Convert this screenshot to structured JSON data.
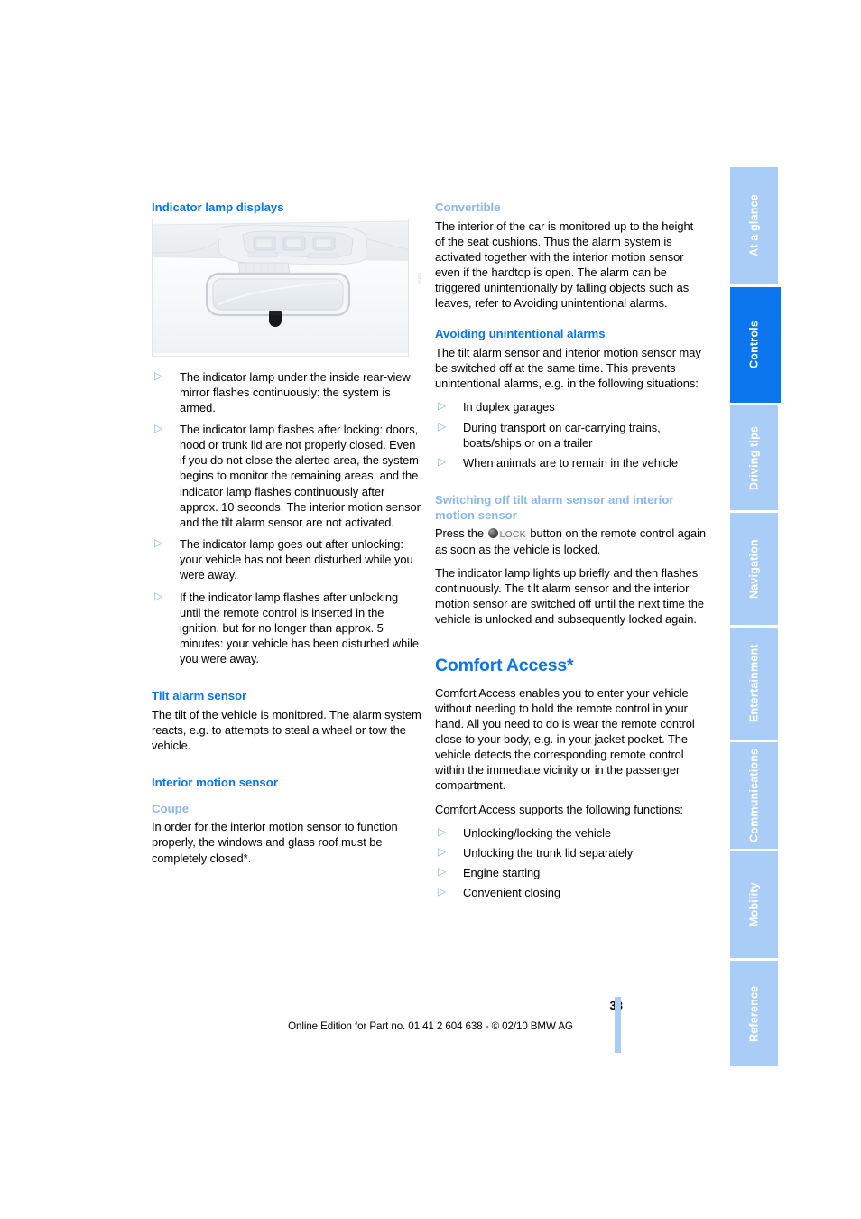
{
  "document": {
    "page_number": "33",
    "footer_note": "Online Edition for Part no. 01 41 2 604 638 - © 02/10 BMW AG"
  },
  "tabs": [
    {
      "label": "At a glance",
      "active": false
    },
    {
      "label": "Controls",
      "active": true
    },
    {
      "label": "Driving tips",
      "active": false
    },
    {
      "label": "Navigation",
      "active": false
    },
    {
      "label": "Entertainment",
      "active": false
    },
    {
      "label": "Communications",
      "active": false
    },
    {
      "label": "Mobility",
      "active": false
    },
    {
      "label": "Reference",
      "active": false
    }
  ],
  "left_column": {
    "indicator_lamp_displays": {
      "heading": "Indicator lamp displays",
      "illustration_caption": "inside-rear-view-mirror-with-indicator-lamp",
      "bullets": [
        "The indicator lamp under the inside rear-view mirror flashes continuously: the system is armed.",
        "The indicator lamp flashes after locking: doors, hood or trunk lid are not properly closed. Even if you do not close the alerted area, the system begins to monitor the remaining areas, and the indicator lamp flashes continuously after approx. 10 seconds. The interior motion sensor and the tilt alarm sensor are not activated.",
        "The indicator lamp goes out after unlocking: your vehicle has not been disturbed while you were away.",
        "If the indicator lamp flashes after unlocking until the remote control is inserted in the ignition, but for no longer than approx. 5 minutes: your vehicle has been disturbed while you were away."
      ]
    },
    "tilt_alarm_sensor": {
      "heading": "Tilt alarm sensor",
      "body": "The tilt of the vehicle is monitored. The alarm system reacts, e.g. to attempts to steal a wheel or tow the vehicle."
    },
    "interior_motion_sensor": {
      "heading": "Interior motion sensor",
      "coupe_heading": "Coupe",
      "coupe_body": "In order for the interior motion sensor to function properly, the windows and glass roof must be completely closed*."
    }
  },
  "right_column": {
    "convertible": {
      "heading": "Convertible",
      "body": "The interior of the car is monitored up to the height of the seat cushions. Thus the alarm system is activated together with the interior motion sensor even if the hardtop is open. The alarm can be triggered unintentionally by falling objects such as leaves, refer to Avoiding unintentional alarms."
    },
    "avoiding_alarms": {
      "heading": "Avoiding unintentional alarms",
      "body": "The tilt alarm sensor and interior motion sensor may be switched off at the same time. This prevents unintentional alarms, e.g. in the following situations:",
      "bullets": [
        "In duplex garages",
        "During transport on car-carrying trains, boats/ships or on a trailer",
        "When animals are to remain in the vehicle"
      ]
    },
    "switching_off": {
      "heading": "Switching off tilt alarm sensor and interior motion sensor",
      "press_prefix": "Press the",
      "lock_icon_name": "lock-button-icon",
      "lock_label": "LOCK",
      "press_suffix": "button on the remote control again as soon as the vehicle is locked.",
      "body": "The indicator lamp lights up briefly and then flashes continuously. The tilt alarm sensor and the interior motion sensor are switched off until the next time the vehicle is unlocked and subsequently locked again."
    },
    "comfort_access": {
      "heading": "Comfort Access*",
      "body1": "Comfort Access enables you to enter your vehicle without needing to hold the remote control in your hand. All you need to do is wear the remote control close to your body, e.g. in your jacket pocket. The vehicle detects the corresponding remote control within the immediate vicinity or in the passenger compartment.",
      "body2": "Comfort Access supports the following functions:",
      "bullets": [
        "Unlocking/locking the vehicle",
        "Unlocking the trunk lid separately",
        "Engine starting",
        "Convenient closing"
      ]
    }
  },
  "colors": {
    "heading_strong": "#0b76ee",
    "heading_light": "#87b8f6",
    "tab_inactive": "#aacdf7",
    "tab_active": "#0b76ee",
    "bullet_marker": "#7fb5f6"
  },
  "bullet_symbol": "▷"
}
